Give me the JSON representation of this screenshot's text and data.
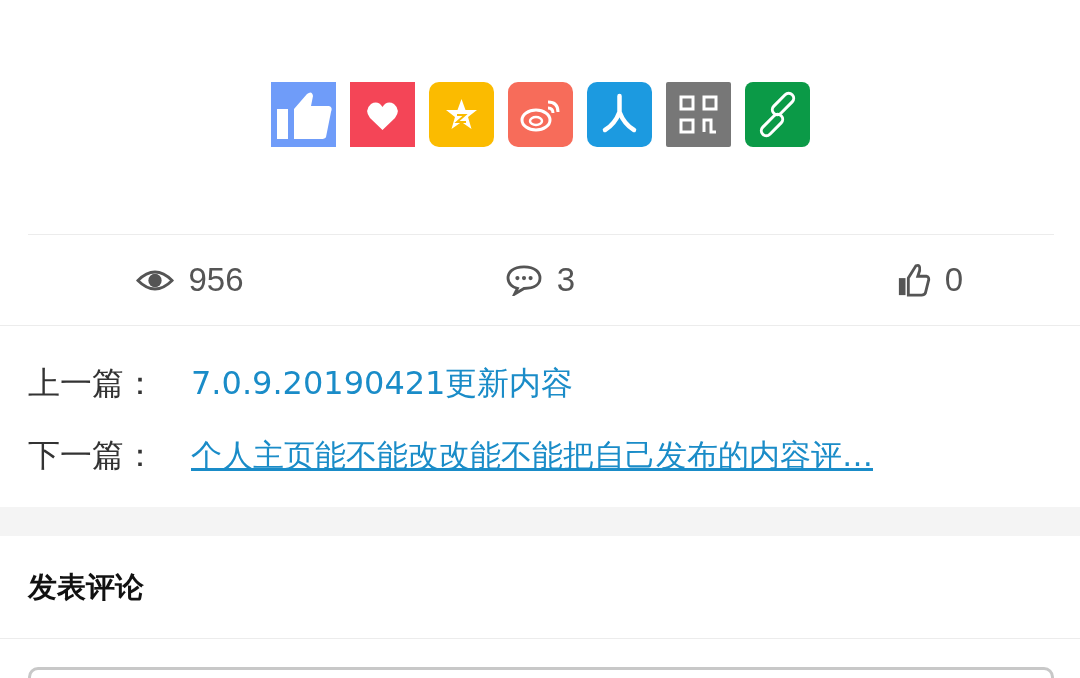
{
  "share_buttons": [
    {
      "kind": "like"
    },
    {
      "kind": "favorite"
    },
    {
      "kind": "star"
    },
    {
      "kind": "weibo"
    },
    {
      "kind": "renren"
    },
    {
      "kind": "qrcode"
    },
    {
      "kind": "link"
    }
  ],
  "stats": [
    {
      "kind": "views",
      "count": "956"
    },
    {
      "kind": "comments",
      "count": "3"
    },
    {
      "kind": "likes",
      "count": "0"
    }
  ],
  "navigation": [
    {
      "label": "上一篇：",
      "title": "7.0.9.20190421更新内容",
      "underlined": false
    },
    {
      "label": "下一篇：",
      "title": "个人主页能不能改改能不能把自己发布的内容评…",
      "underlined": true
    }
  ],
  "comment_section": {
    "title": "发表评论"
  }
}
